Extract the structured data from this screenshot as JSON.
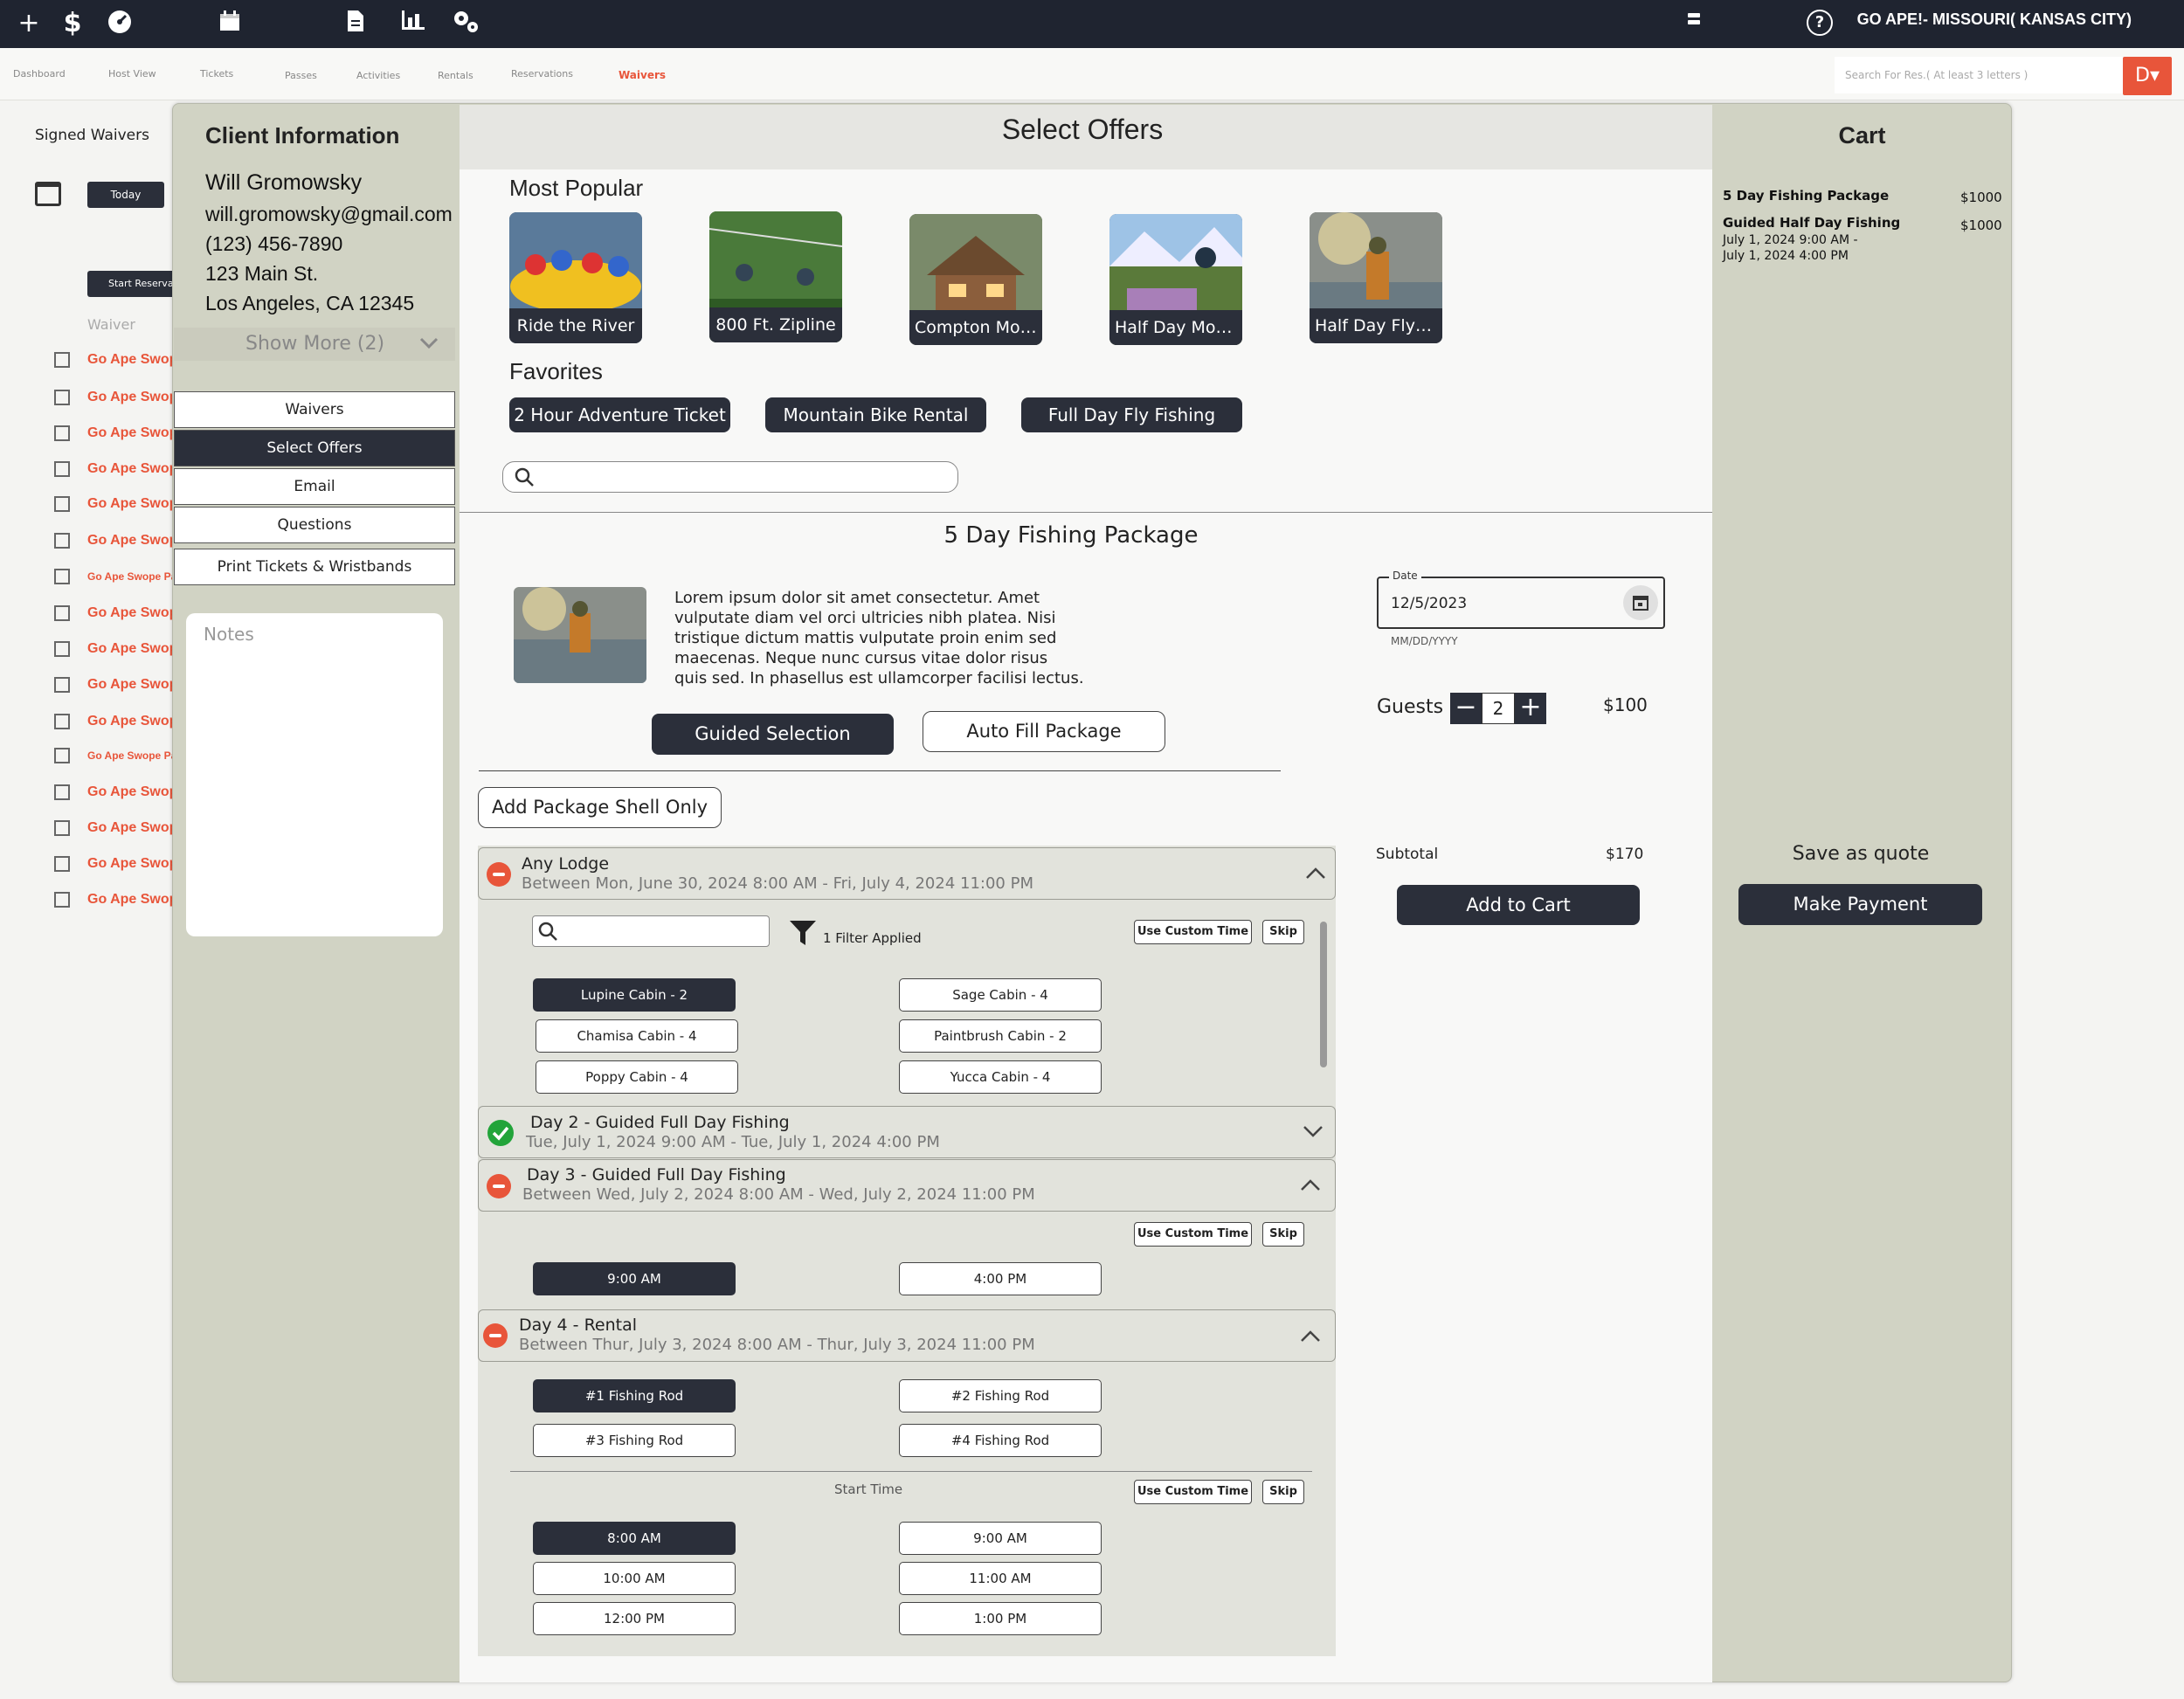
{
  "topbar": {
    "location": "GO APE!- MISSOURI( KANSAS CITY)",
    "icons": [
      "plus-icon",
      "dollar-icon",
      "gauge-icon",
      "calendar-icon",
      "document-icon",
      "chart-icon",
      "gears-icon",
      "grid-icon",
      "help-icon"
    ]
  },
  "nav": {
    "items": [
      "Dashboard",
      "Host View",
      "Tickets",
      "Passes",
      "Activities",
      "Rentals",
      "Reservations",
      "Waivers"
    ],
    "active": "Waivers",
    "search_placeholder": "Search For Res.( At least 3 letters )",
    "user_initial": "D▾",
    "accent": "#e8553a"
  },
  "left_panel": {
    "title": "Signed Waivers",
    "today_label": "Today",
    "start_label": "Start Reservation",
    "waiver_header": "Waiver",
    "waivers": [
      "Go Ape Swope Park",
      "Go Ape Swope Park",
      "Go Ape Swope Park",
      "Go Ape Swope Park",
      "Go Ape Swope Park",
      "Go Ape Swope Park",
      "Go Ape Swope Park",
      "Go Ape Swope Park",
      "Go Ape Swope Park",
      "Go Ape Swope Park",
      "Go Ape Swope Park",
      "Go Ape Swope Park",
      "Go Ape Swope Park",
      "Go Ape Swope Park",
      "Go Ape Swope Park",
      "Go Ape Swope Park"
    ]
  },
  "client": {
    "title": "Client Information",
    "name": "Will Gromowsky",
    "email": "will.gromowsky@gmail.com",
    "phone": "(123) 456-7890",
    "address1": "123 Main St.",
    "address2": "Los Angeles, CA 12345",
    "show_more": "Show More (2)",
    "menu": [
      "Waivers",
      "Select Offers",
      "Email",
      "Questions",
      "Print Tickets & Wristbands"
    ],
    "active_menu": "Select Offers",
    "notes_placeholder": "Notes"
  },
  "offers": {
    "title": "Select Offers",
    "most_popular_label": "Most Popular",
    "popular": [
      "Ride the River",
      "800 Ft. Zipline",
      "Compton Mountain Lodge",
      "Half Day Mountain Biking",
      "Half Day Flyfishing"
    ],
    "favorites_label": "Favorites",
    "favorites": [
      "2 Hour Adventure Ticket",
      "Mountain Bike Rental",
      "Full Day Fly Fishing"
    ]
  },
  "package": {
    "title": "5 Day Fishing Package",
    "description": "Lorem ipsum dolor sit amet consectetur. Amet vulputate diam vel orci ultricies nibh platea. Nisi tristique dictum mattis vulputate proin enim sed maecenas. Neque nunc cursus vitae dolor risus quis sed. In phasellus est ullamcorper facilisi lectus.",
    "guided_label": "Guided Selection",
    "autofill_label": "Auto Fill Package",
    "shell_label": "Add Package Shell Only",
    "date_label": "Date",
    "date_value": "12/5/2023",
    "date_hint": "MM/DD/YYYY",
    "guests_label": "Guests",
    "guests_value": "2",
    "guests_price": "$100",
    "subtotal_label": "Subtotal",
    "subtotal_value": "$170",
    "add_to_cart": "Add to Cart"
  },
  "sections": {
    "lodge": {
      "title": "Any Lodge",
      "subtitle": "Between Mon, June 30, 2024 8:00 AM - Fri, July 4, 2024 11:00 PM",
      "filter_text": "1 Filter Applied",
      "custom_time": "Use Custom Time",
      "skip": "Skip",
      "cabins": [
        "Lupine Cabin - 2",
        "Sage Cabin - 4",
        "Chamisa Cabin - 4",
        "Paintbrush Cabin - 2",
        "Poppy Cabin - 4",
        "Yucca Cabin - 4"
      ]
    },
    "day2": {
      "title": "Day 2 - Guided Full Day Fishing",
      "subtitle": "Tue, July 1, 2024 9:00 AM - Tue, July 1, 2024 4:00 PM"
    },
    "day3": {
      "title": "Day 3 - Guided Full Day Fishing",
      "subtitle": "Between Wed, July 2, 2024 8:00 AM - Wed, July 2, 2024 11:00 PM",
      "custom_time": "Use Custom Time",
      "skip": "Skip",
      "times": [
        "9:00 AM",
        "4:00 PM"
      ]
    },
    "day4": {
      "title": "Day 4 - Rental",
      "subtitle": "Between Thur, July 3, 2024 8:00 AM - Thur, July 3, 2024 11:00 PM",
      "rods": [
        "#1 Fishing Rod",
        "#2 Fishing Rod",
        "#3 Fishing Rod",
        "#4 Fishing Rod"
      ],
      "start_time_label": "Start Time",
      "custom_time": "Use Custom Time",
      "skip": "Skip",
      "times": [
        "8:00 AM",
        "9:00 AM",
        "10:00 AM",
        "11:00 AM",
        "12:00 PM",
        "1:00 PM"
      ]
    }
  },
  "cart": {
    "title": "Cart",
    "item1_name": "5 Day Fishing Package",
    "item1_price": "$1000",
    "item2_name": "Guided Half Day Fishing",
    "item2_price": "$1000",
    "item2_line1": "July 1, 2024 9:00 AM -",
    "item2_line2": "July 1, 2024 4:00 PM",
    "save_quote": "Save as quote",
    "make_payment": "Make Payment"
  }
}
